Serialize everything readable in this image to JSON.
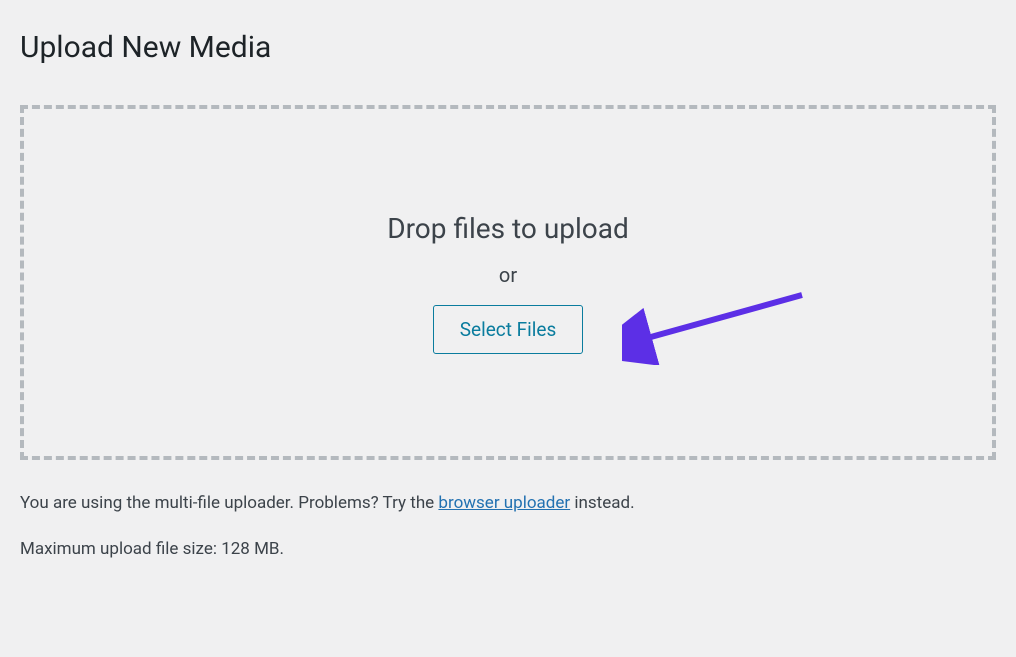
{
  "header": {
    "title": "Upload New Media"
  },
  "uploader": {
    "drop_instructions": "Drop files to upload",
    "or_label": "or",
    "select_button_label": "Select Files"
  },
  "notices": {
    "multi_file_prefix": "You are using the multi-file uploader. Problems? Try the ",
    "browser_uploader_link": "browser uploader",
    "multi_file_suffix": " instead.",
    "max_size": "Maximum upload file size: 128 MB."
  },
  "annotation": {
    "arrow_color": "#5c2fe6"
  }
}
